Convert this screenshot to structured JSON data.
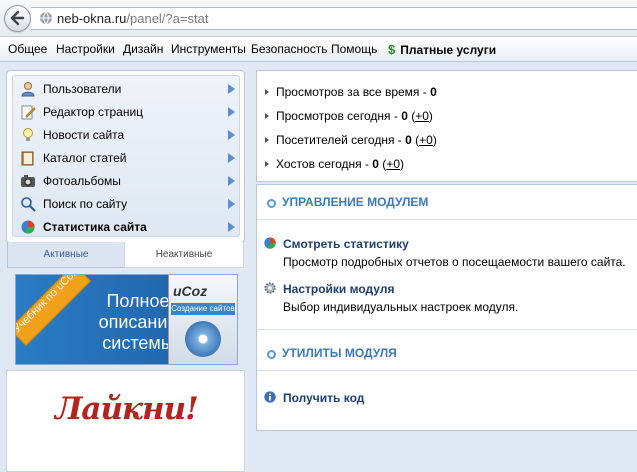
{
  "browser": {
    "url_host": "neb-okna.ru",
    "url_path": "/panel/?a=stat"
  },
  "menu": {
    "items": [
      "Общее",
      "Настройки",
      "Дизайн",
      "Инструменты",
      "Безопасность",
      "Помощь"
    ],
    "paid_label": "Платные услуги",
    "paid_icon": "dollar-icon"
  },
  "sidebar": {
    "items": [
      {
        "label": "Пользователи",
        "icon": "user-icon"
      },
      {
        "label": "Редактор страниц",
        "icon": "pencil-icon"
      },
      {
        "label": "Новости сайта",
        "icon": "lightbulb-icon"
      },
      {
        "label": "Каталог статей",
        "icon": "book-icon"
      },
      {
        "label": "Фотоальбомы",
        "icon": "camera-icon"
      },
      {
        "label": "Поиск по сайту",
        "icon": "magnifier-icon"
      },
      {
        "label": "Статистика сайта",
        "icon": "pie-chart-icon"
      }
    ],
    "active_index": 6,
    "tabs": {
      "active": "Активные",
      "inactive": "Неактивные"
    }
  },
  "banner": {
    "ribbon": "Учебник по uCoz",
    "text": "Полное описание системы",
    "box_title": "uCoz",
    "box_sub": "Создание сайтов"
  },
  "like_box": {
    "text": "Лайкни!"
  },
  "stats": {
    "total_label": "Просмотров за все время - ",
    "total_value": "0",
    "today_label": "Просмотров сегодня - ",
    "today_value": "0",
    "today_delta": "+0",
    "visitors_label": "Посетителей сегодня - ",
    "visitors_value": "0",
    "visitors_delta": "+0",
    "hosts_label": "Хостов сегодня - ",
    "hosts_value": "0",
    "hosts_delta": "+0"
  },
  "module": {
    "manage_heading": "УПРАВЛЕНИЕ МОДУЛЕМ",
    "actions": [
      {
        "title": "Смотреть статистику",
        "desc": "Просмотр подробных отчетов о посещаемости вашего сайта.",
        "icon": "pie-chart-icon"
      },
      {
        "title": "Настройки модуля",
        "desc": "Выбор индивидуальных настроек модуля.",
        "icon": "gear-icon"
      }
    ],
    "utils_heading": "УТИЛИТЫ МОДУЛЯ",
    "utils": [
      {
        "title": "Получить код",
        "icon": "info-icon"
      }
    ]
  }
}
